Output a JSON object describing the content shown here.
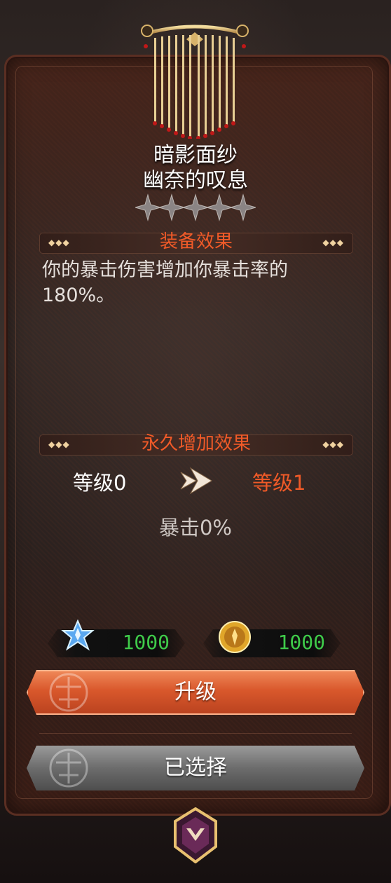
{
  "item": {
    "name": "暗影面纱",
    "subtitle": "幽奈的叹息",
    "stars_total": 5,
    "stars_filled": 0
  },
  "equip_effect": {
    "title": "装备效果",
    "description": "你的暴击伤害增加你暴击率的180%。"
  },
  "permanent_effect": {
    "title": "永久增加效果",
    "current_level": "等级0",
    "next_level": "等级1",
    "stat": "暴击0%"
  },
  "costs": [
    {
      "icon": "blue-star-crystal-icon",
      "value": "1000"
    },
    {
      "icon": "gold-coin-icon",
      "value": "1000"
    }
  ],
  "buttons": {
    "upgrade_label": "升级",
    "selected_label": "已选择"
  },
  "colors": {
    "accent_orange": "#f05a28",
    "cost_green": "#3fcb4a",
    "upgrade_button": "#d9582c",
    "selected_button": "#6c6c6c"
  }
}
